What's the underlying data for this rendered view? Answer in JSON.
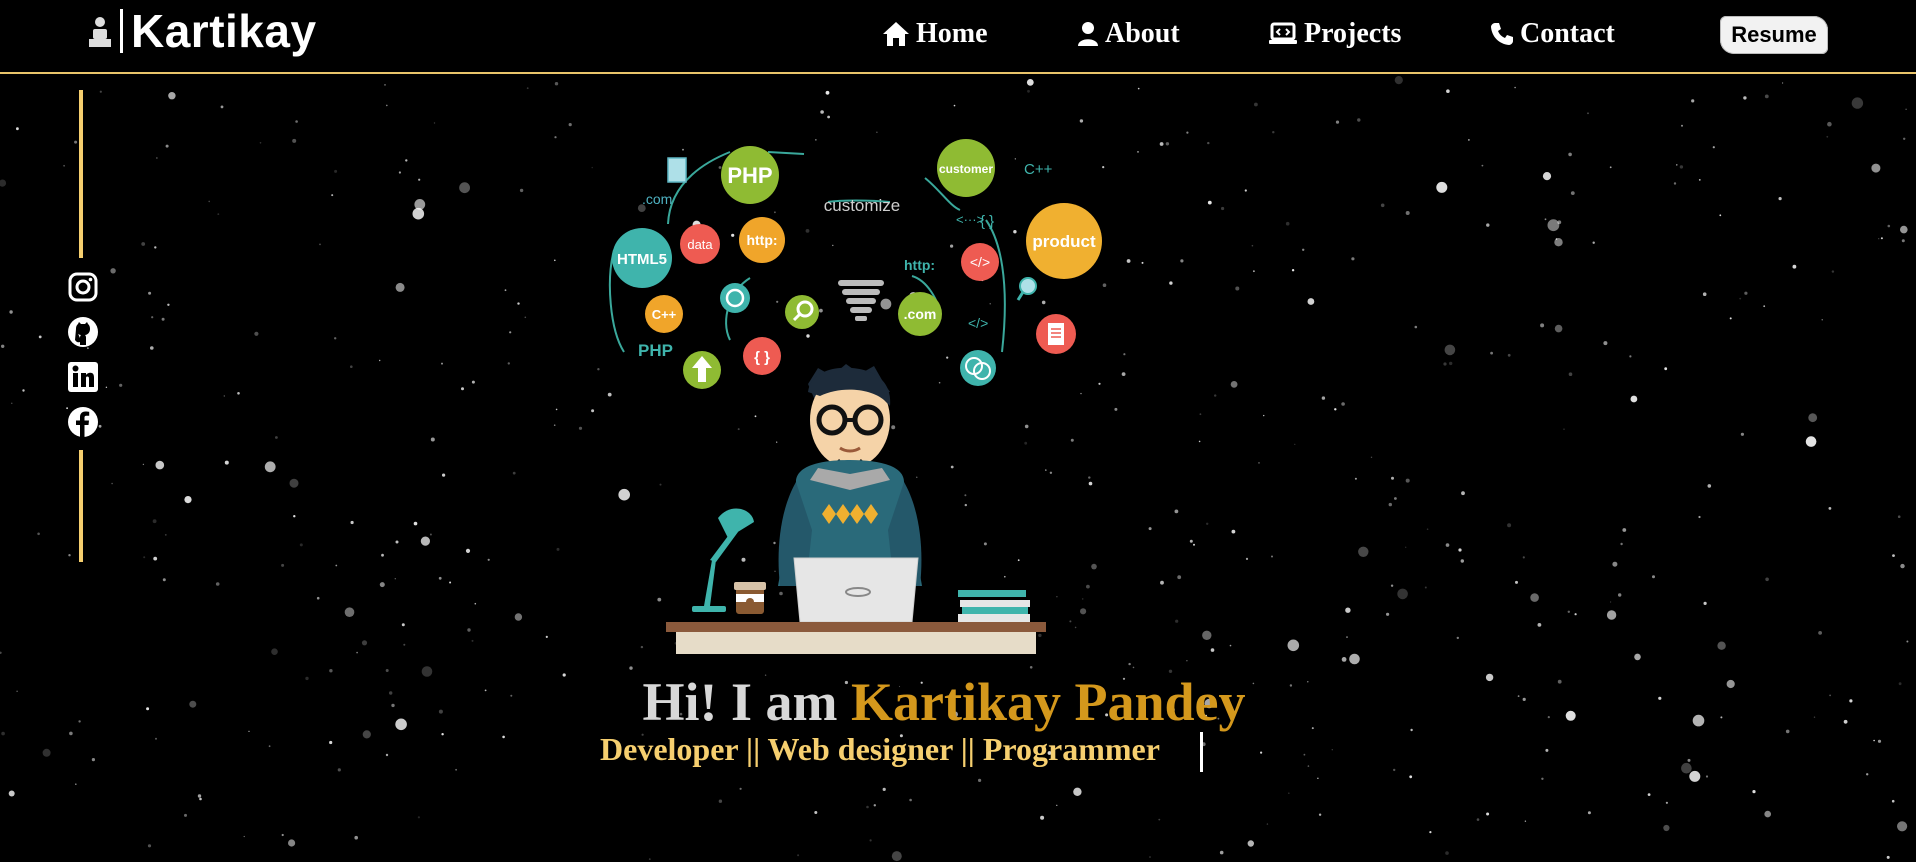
{
  "brand": {
    "name": "Kartikay"
  },
  "nav": {
    "home": "Home",
    "about": "About",
    "projects": "Projects",
    "contact": "Contact",
    "resume": "Resume"
  },
  "social": [
    "instagram-icon",
    "github-icon",
    "linkedin-icon",
    "facebook-icon"
  ],
  "hero": {
    "greeting": "Hi! I am ",
    "name": "Kartikay Pandey",
    "subtitle": "Developer || Web designer || Programmer"
  },
  "illustration": {
    "bubbles": [
      "PHP",
      "customer",
      "C++",
      ".com",
      "customize",
      "HTML5",
      "data",
      "http:",
      "{ }",
      "product",
      "http:",
      "</>",
      "C++",
      "PHP",
      "{ }",
      ".com",
      "</>"
    ]
  },
  "colors": {
    "accent": "#f6cf6f",
    "name": "#d4981c",
    "background": "#000000"
  }
}
